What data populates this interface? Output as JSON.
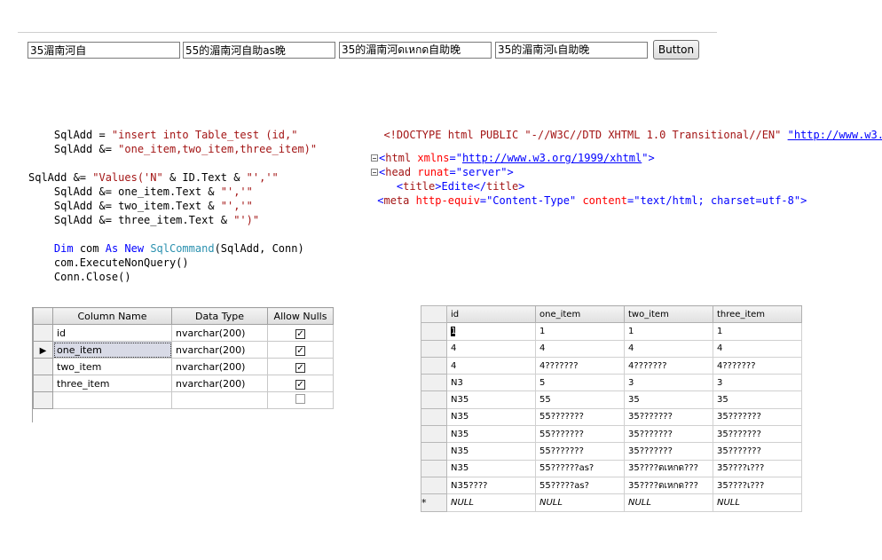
{
  "top_inputs": [
    {
      "value": "35湄南河自"
    },
    {
      "value": "55的湄南河自助as晚"
    },
    {
      "value": "35的湄南河ดเหกด自助晚"
    },
    {
      "value": "35的湄南河เ自助晚"
    }
  ],
  "button_label": "Button",
  "vb_code": {
    "l1a": "    SqlAdd = ",
    "l1b": "\"insert into Table_test (id,\"",
    "l2a": "    SqlAdd &= ",
    "l2b": "\"one_item,two_item,three_item)\"",
    "l3a": "SqlAdd &= ",
    "l3b": "\"Values('N\"",
    "l3c": " & ID.Text & ",
    "l3d": "\"','\"",
    "l4a": "    SqlAdd &= one_item.Text & ",
    "l4b": "\"','\"",
    "l5a": "    SqlAdd &= two_item.Text & ",
    "l5b": "\"','\"",
    "l6a": "    SqlAdd &= three_item.Text & ",
    "l6b": "\"')\"",
    "l7a": "    ",
    "l7b": "Dim",
    "l7c": " com ",
    "l7d": "As New",
    "l7e": " ",
    "l7f": "SqlCommand",
    "l7g": "(SqlAdd, Conn)",
    "l8": "    com.ExecuteNonQuery()",
    "l9": "    Conn.Close()"
  },
  "html_code": {
    "d1": "<!DOCTYPE html PUBLIC \"-//W3C//DTD XHTML 1.0 Transitional//EN\" ",
    "d2": "\"http://www.w3.",
    "h1": "<",
    "h2": "html",
    "h3": " xmlns",
    "h4": "=\"",
    "h5": "http://www.w3.org/1999/xhtml",
    "h6": "\">",
    "hd1": "<",
    "hd2": "head",
    "hd3": " runat",
    "hd4": "=\"server\">",
    "t1": "    <",
    "t2": "title",
    "t3": ">Edite</",
    "t4": "title",
    "t5": ">",
    "m1": "<",
    "m2": "meta",
    "m3": " http-equiv",
    "m4": "=\"Content-Type\"",
    "m5": " content",
    "m6": "=\"text/html; charset=utf-8\"",
    "m7": ">"
  },
  "design_table": {
    "headers": [
      "Column Name",
      "Data Type",
      "Allow Nulls"
    ],
    "rows": [
      {
        "name": "id",
        "type": "nvarchar(200)",
        "nulls": true
      },
      {
        "name": "one_item",
        "type": "nvarchar(200)",
        "nulls": true
      },
      {
        "name": "two_item",
        "type": "nvarchar(200)",
        "nulls": true
      },
      {
        "name": "three_item",
        "type": "nvarchar(200)",
        "nulls": true
      },
      {
        "name": "",
        "type": "",
        "nulls": false
      }
    ],
    "check_mark": "☑",
    "row_pointer": "▶"
  },
  "data_table": {
    "headers": [
      "id",
      "one_item",
      "two_item",
      "three_item"
    ],
    "rows": [
      [
        "1",
        "1",
        "1",
        "1"
      ],
      [
        "4",
        "4",
        "4",
        "4"
      ],
      [
        "4",
        "4???????",
        "4???????",
        "4???????"
      ],
      [
        "N3",
        "5",
        "3",
        "3"
      ],
      [
        "N35",
        "55",
        "35",
        "35"
      ],
      [
        "N35",
        "55???????",
        "35???????",
        "35???????"
      ],
      [
        "N35",
        "55???????",
        "35???????",
        "35???????"
      ],
      [
        "N35",
        "55???????",
        "35???????",
        "35???????"
      ],
      [
        "N35",
        "55??????as?",
        "35????ดเหกด???",
        "35????เ???"
      ],
      [
        "N35????",
        "55?????as?",
        "35????ดเหกด???",
        "35????เ???"
      ]
    ],
    "new_row_marker": "*",
    "null_label": "NULL"
  }
}
